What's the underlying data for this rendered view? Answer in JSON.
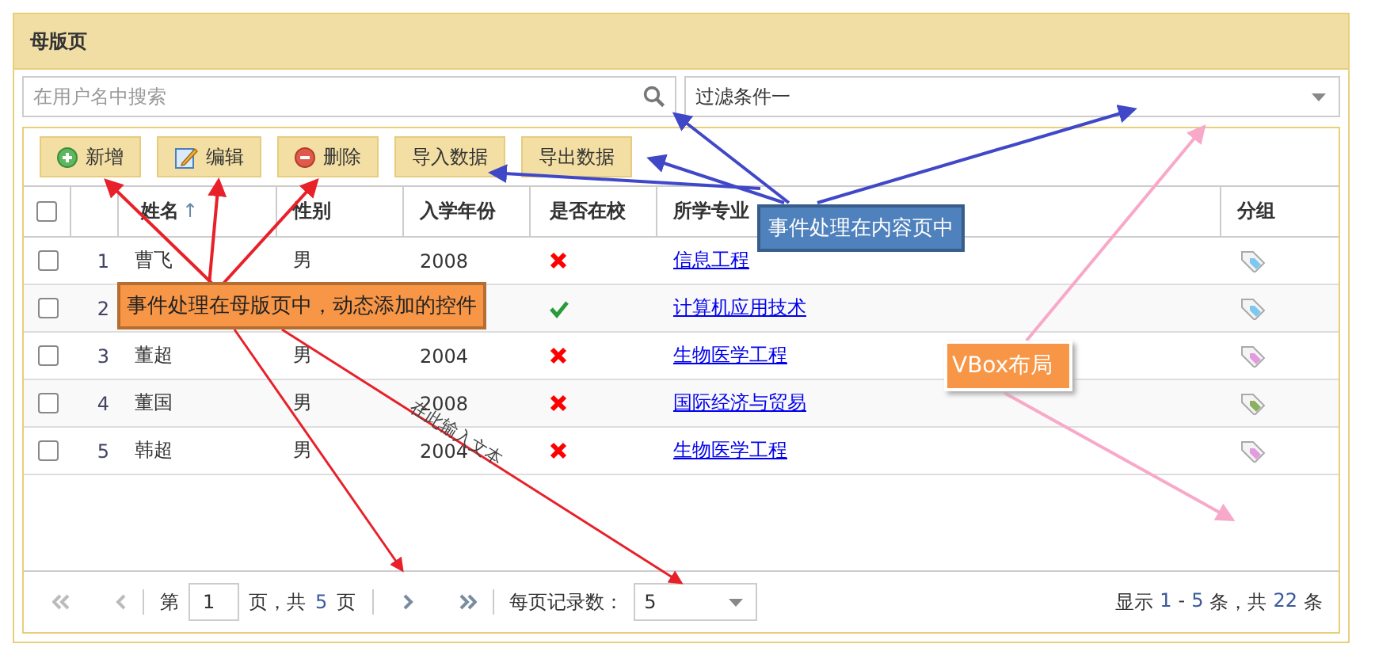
{
  "panel": {
    "title": "母版页"
  },
  "search": {
    "placeholder": "在用户名中搜索"
  },
  "filter": {
    "value": "过滤条件一"
  },
  "toolbar": [
    {
      "label": "新增",
      "kind": "add"
    },
    {
      "label": "编辑",
      "kind": "edit"
    },
    {
      "label": "删除",
      "kind": "delete"
    },
    {
      "label": "导入数据",
      "kind": "plain"
    },
    {
      "label": "导出数据",
      "kind": "plain"
    }
  ],
  "table": {
    "header_checked": false,
    "columns": [
      {
        "label": "姓名",
        "sort": "↑"
      },
      {
        "label": "性别"
      },
      {
        "label": "入学年份"
      },
      {
        "label": "是否在校"
      },
      {
        "label": "所学专业"
      },
      {
        "label": "分组"
      }
    ],
    "rows": [
      {
        "checked": false,
        "index": "1",
        "name": "曹飞",
        "gender": "男",
        "year": "2008",
        "in_school": false,
        "major": "信息工程",
        "color": "#7cc8f0"
      },
      {
        "checked": false,
        "index": "2",
        "in_school": true,
        "major": "计算机应用技术",
        "color": "#7cc8f0"
      },
      {
        "checked": false,
        "index": "3",
        "name": "董超",
        "gender": "男",
        "year": "2004",
        "in_school": false,
        "major": "生物医学工程",
        "color": "#e39be0"
      },
      {
        "checked": false,
        "index": "4",
        "name": "董国",
        "gender": "男",
        "year": "2008",
        "in_school": false,
        "major": "国际经济与贸易",
        "color": "#8bb060"
      },
      {
        "checked": false,
        "index": "5",
        "name": "韩超",
        "gender": "男",
        "year": "2004",
        "in_school": false,
        "major": "生物医学工程",
        "color": "#e39be0"
      }
    ]
  },
  "pager": {
    "page_prefix": "第",
    "page": "1",
    "page_mid": "页，共",
    "pages": "5",
    "page_suffix": "页",
    "size_label": "每页记录数：",
    "size": "5",
    "info": [
      "显示",
      "1",
      "-",
      "5",
      "条，共",
      "22",
      "条"
    ]
  },
  "annotations": [
    {
      "text": "事件处理在内容页中",
      "kind": "blue"
    },
    {
      "text": "事件处理在母版页中，动态添加的控件",
      "kind": "orange"
    },
    {
      "text": "VBox布局",
      "kind": "vbox"
    },
    {
      "text": "在此输入文本",
      "kind": "rotated"
    }
  ]
}
